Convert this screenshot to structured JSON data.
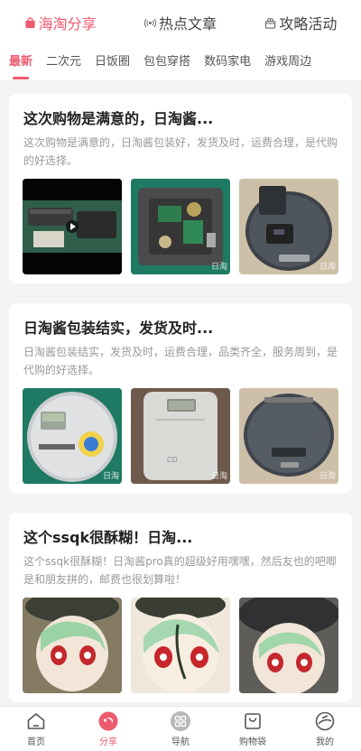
{
  "top_tabs": [
    {
      "label": "海淘分享",
      "icon": "bag-icon"
    },
    {
      "label": "热点文章",
      "icon": "broadcast-icon"
    },
    {
      "label": "攻略活动",
      "icon": "gift-icon"
    }
  ],
  "sub_tabs": [
    "最新",
    "二次元",
    "日饭圈",
    "包包穿搭",
    "数码家电",
    "游戏周边"
  ],
  "posts": [
    {
      "title": "这次购物是满意的，日淘酱...",
      "desc": "这次购物是满意的，日淘酱包装好，发货及时，运费合理，是代购的好选择。",
      "watermark": "日淘"
    },
    {
      "title": "日淘酱包装结实，发货及时...",
      "desc": "日淘酱包装结实，发货及时，运费合理，品类齐全，服务周到，是代购的好选择。",
      "watermark": "日淘"
    },
    {
      "title": "这个ssqk很酥糊！日淘...",
      "desc": "这个ssqk很酥糊！日淘酱pro真的超级好用嘿嘿，然后友也的吧唧是和朋友拼的，邮费也很划算啦！",
      "watermark": ""
    }
  ],
  "bottom_nav": [
    {
      "label": "首页",
      "icon": "home-icon"
    },
    {
      "label": "分享",
      "icon": "share-icon"
    },
    {
      "label": "导航",
      "icon": "grid-icon"
    },
    {
      "label": "购物袋",
      "icon": "shopping-bag-icon"
    },
    {
      "label": "我的",
      "icon": "profile-icon"
    }
  ],
  "colors": {
    "accent": "#ee5a6f",
    "background": "#f4f4f4"
  }
}
